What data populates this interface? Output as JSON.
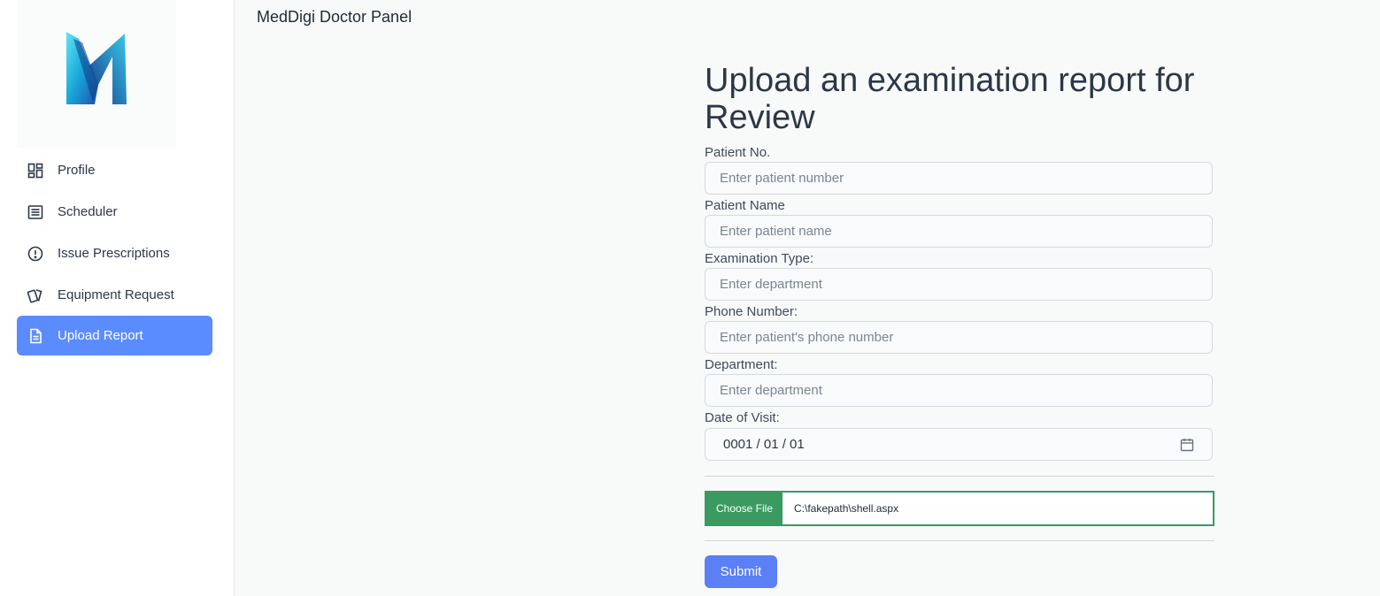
{
  "app": {
    "title": "MedDigi Doctor Panel"
  },
  "sidebar": {
    "items": [
      {
        "label": "Profile",
        "icon": "dashboard-icon"
      },
      {
        "label": "Scheduler",
        "icon": "list-icon"
      },
      {
        "label": "Issue Prescriptions",
        "icon": "alert-circle-icon"
      },
      {
        "label": "Equipment Request",
        "icon": "cards-icon"
      },
      {
        "label": "Upload Report",
        "icon": "document-icon",
        "active": true
      }
    ]
  },
  "form": {
    "heading": "Upload an examination report for Review",
    "fields": [
      {
        "label": "Patient No.",
        "placeholder": "Enter patient number"
      },
      {
        "label": "Patient Name",
        "placeholder": "Enter patient name"
      },
      {
        "label": "Examination Type:",
        "placeholder": "Enter department"
      },
      {
        "label": "Phone Number:",
        "placeholder": "Enter patient's phone number"
      },
      {
        "label": "Department:",
        "placeholder": "Enter department"
      }
    ],
    "date": {
      "label": "Date of Visit:",
      "value": "0001 / 01 / 01"
    },
    "file": {
      "button_label": "Choose File",
      "file_name": "C:\\fakepath\\shell.aspx"
    },
    "submit_label": "Submit"
  },
  "colors": {
    "accent": "#5b8cff",
    "submit": "#5b7ff5",
    "file_border": "#3a9a60"
  }
}
